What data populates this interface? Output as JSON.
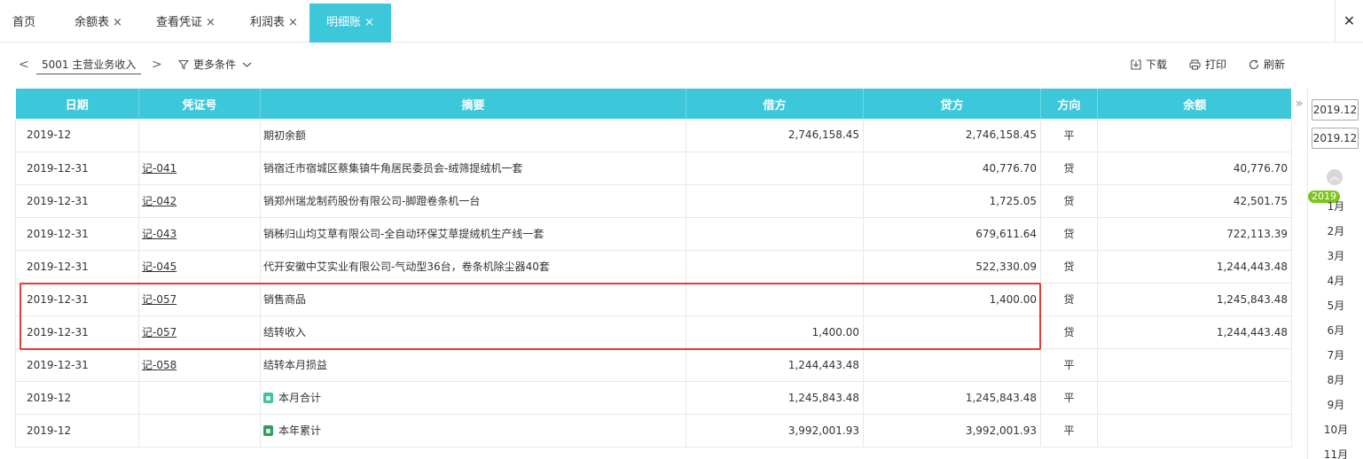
{
  "tabs": [
    {
      "label": "首页",
      "closable": false,
      "active": false
    },
    {
      "label": "余额表",
      "closable": true,
      "active": false
    },
    {
      "label": "查看凭证",
      "closable": true,
      "active": false
    },
    {
      "label": "利润表",
      "closable": true,
      "active": false
    },
    {
      "label": "明细账",
      "closable": true,
      "active": true
    }
  ],
  "tab_close_glyph": "×",
  "window_close_glyph": "✕",
  "toolbar": {
    "prev_glyph": "<",
    "next_glyph": ">",
    "account": "5001  主营业务收入",
    "more_conditions": "更多条件",
    "download": "下载",
    "print": "打印",
    "refresh": "刷新"
  },
  "table": {
    "headers": [
      "日期",
      "凭证号",
      "摘要",
      "借方",
      "贷方",
      "方向",
      "余额"
    ],
    "rows": [
      {
        "date": "2019-12",
        "voucher": "",
        "summary": "期初余额",
        "debit": "2,746,158.45",
        "credit": "2,746,158.45",
        "direction": "平",
        "balance": "",
        "icon": ""
      },
      {
        "date": "2019-12-31",
        "voucher": "记-041",
        "summary": "销宿迁市宿城区蔡集镇牛角居民委员会-绒筛提绒机一套",
        "debit": "",
        "credit": "40,776.70",
        "direction": "贷",
        "balance": "40,776.70",
        "icon": ""
      },
      {
        "date": "2019-12-31",
        "voucher": "记-042",
        "summary": "销郑州瑞龙制药股份有限公司-脚蹬卷条机一台",
        "debit": "",
        "credit": "1,725.05",
        "direction": "贷",
        "balance": "42,501.75",
        "icon": ""
      },
      {
        "date": "2019-12-31",
        "voucher": "记-043",
        "summary": "销秭归山均艾草有限公司-全自动环保艾草提绒机生产线一套",
        "debit": "",
        "credit": "679,611.64",
        "direction": "贷",
        "balance": "722,113.39",
        "icon": ""
      },
      {
        "date": "2019-12-31",
        "voucher": "记-045",
        "summary": "代开安徽中艾实业有限公司-气动型36台，卷条机除尘器40套",
        "debit": "",
        "credit": "522,330.09",
        "direction": "贷",
        "balance": "1,244,443.48",
        "icon": ""
      },
      {
        "date": "2019-12-31",
        "voucher": "记-057",
        "summary": "销售商品",
        "debit": "",
        "credit": "1,400.00",
        "direction": "贷",
        "balance": "1,245,843.48",
        "icon": ""
      },
      {
        "date": "2019-12-31",
        "voucher": "记-057",
        "summary": "结转收入",
        "debit": "1,400.00",
        "credit": "",
        "direction": "贷",
        "balance": "1,244,443.48",
        "icon": ""
      },
      {
        "date": "2019-12-31",
        "voucher": "记-058",
        "summary": "结转本月损益",
        "debit": "1,244,443.48",
        "credit": "",
        "direction": "平",
        "balance": "",
        "icon": ""
      },
      {
        "date": "2019-12",
        "voucher": "",
        "summary": "本月合计",
        "debit": "1,245,843.48",
        "credit": "1,245,843.48",
        "direction": "平",
        "balance": "",
        "icon": "month-total-icon"
      },
      {
        "date": "2019-12",
        "voucher": "",
        "summary": "本年累计",
        "debit": "3,992,001.93",
        "credit": "3,992,001.93",
        "direction": "平",
        "balance": "",
        "icon": "year-total-icon"
      }
    ]
  },
  "collapse_glyph": "»",
  "sidebar": {
    "period_start": "2019.12",
    "period_end": "2019.12",
    "year": "2019",
    "months": [
      "1月",
      "2月",
      "3月",
      "4月",
      "5月",
      "6月",
      "7月",
      "8月",
      "9月",
      "10月",
      "11月"
    ]
  },
  "colors": {
    "accent": "#3dc7db",
    "highlight_border": "#e53a3a",
    "year_badge": "#7cc61e",
    "month_total_icon": "#3fc2a4",
    "year_total_icon": "#2e9e5b"
  }
}
